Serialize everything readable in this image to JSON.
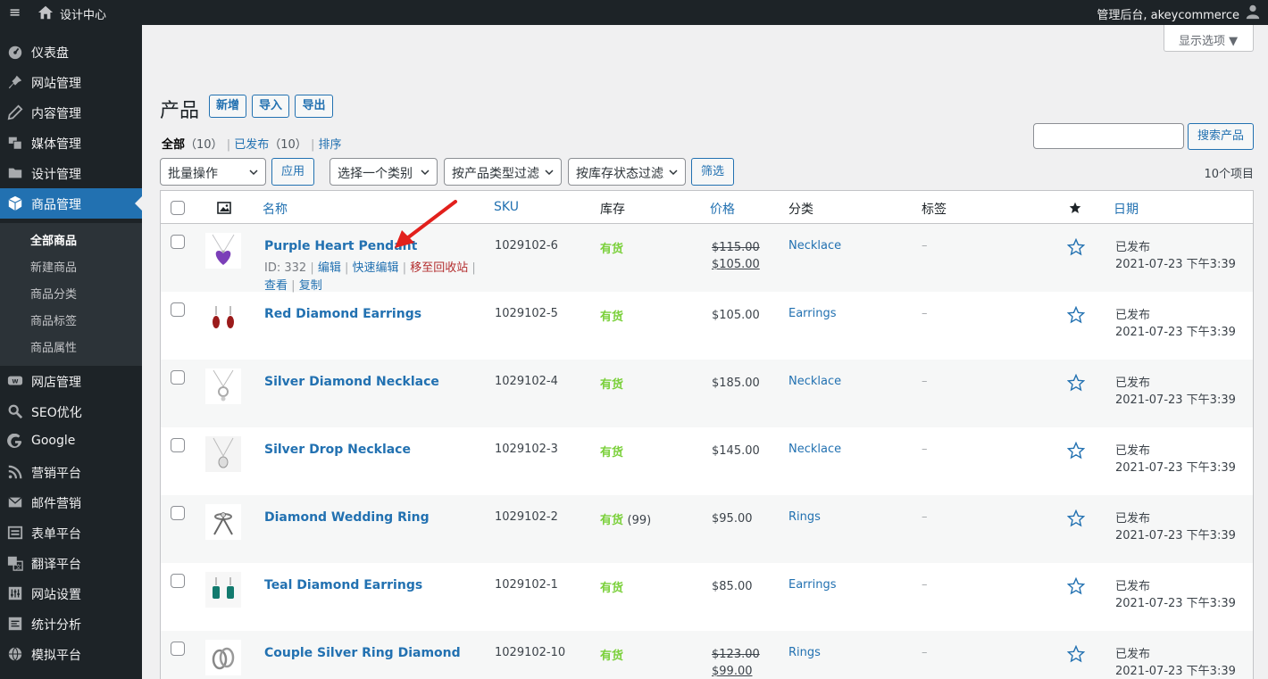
{
  "adminbar": {
    "menu_icon": "≡",
    "site_name": "设计中心",
    "account": "管理后台, akeycommerce"
  },
  "sidebar": {
    "items": [
      {
        "label": "仪表盘",
        "icon": "dashboard-icon"
      },
      {
        "label": "网站管理",
        "icon": "pin-icon"
      },
      {
        "label": "内容管理",
        "icon": "edit-icon"
      },
      {
        "label": "媒体管理",
        "icon": "media-icon"
      },
      {
        "label": "设计管理",
        "icon": "folder-icon"
      },
      {
        "label": "商品管理",
        "icon": "box-icon",
        "active": true
      },
      {
        "label": "网店管理",
        "icon": "woo-icon"
      },
      {
        "label": "SEO优化",
        "icon": "search-icon"
      },
      {
        "label": "Google",
        "icon": "google-icon"
      },
      {
        "label": "营销平台",
        "icon": "rss-icon"
      },
      {
        "label": "邮件营销",
        "icon": "mail-icon"
      },
      {
        "label": "表单平台",
        "icon": "form-icon"
      },
      {
        "label": "翻译平台",
        "icon": "translate-icon"
      },
      {
        "label": "网站设置",
        "icon": "settings-icon"
      },
      {
        "label": "统计分析",
        "icon": "chart-icon"
      },
      {
        "label": "模拟平台",
        "icon": "globe-icon"
      }
    ],
    "submenu": [
      "全部商品",
      "新建商品",
      "商品分类",
      "商品标签",
      "商品属性"
    ]
  },
  "screen_options": "显示选项 ▼",
  "page": {
    "title": "产品",
    "buttons": {
      "new": "新增",
      "import": "导入",
      "export": "导出"
    }
  },
  "views": {
    "all": "全部",
    "all_count": "（10）",
    "sep": "|",
    "published": "已发布",
    "published_count": "（10）",
    "sort": "排序"
  },
  "search": {
    "placeholder": "",
    "button": "搜索产品"
  },
  "filters": {
    "bulk": "批量操作",
    "apply": "应用",
    "category": "选择一个类别",
    "type": "按产品类型过滤",
    "stock": "按库存状态过滤",
    "filter_btn": "筛选",
    "count": "10个项目"
  },
  "columns": {
    "name": "名称",
    "sku": "SKU",
    "stock": "库存",
    "price": "价格",
    "category": "分类",
    "tags": "标签",
    "date": "日期"
  },
  "row_actions": {
    "id": "ID: 332",
    "edit": "编辑",
    "quick_edit": "快速编辑",
    "trash": "移至回收站",
    "view": "查看",
    "duplicate": "复制",
    "sep": "|"
  },
  "products": [
    {
      "name": "Purple Heart Pendant",
      "sku": "1029102-6",
      "stock": "有货",
      "stock_qty": "",
      "old_price": "$115.00",
      "price": "$105.00",
      "category": "Necklace",
      "tags": "–",
      "status": "已发布",
      "date": "2021-07-23 下午3:39",
      "thumb": "purple-heart"
    },
    {
      "name": "Red Diamond Earrings",
      "sku": "1029102-5",
      "stock": "有货",
      "stock_qty": "",
      "old_price": "",
      "price": "$105.00",
      "category": "Earrings",
      "tags": "–",
      "status": "已发布",
      "date": "2021-07-23 下午3:39",
      "thumb": "red-earrings"
    },
    {
      "name": "Silver Diamond Necklace",
      "sku": "1029102-4",
      "stock": "有货",
      "stock_qty": "",
      "old_price": "",
      "price": "$185.00",
      "category": "Necklace",
      "tags": "–",
      "status": "已发布",
      "date": "2021-07-23 下午3:39",
      "thumb": "silver-necklace"
    },
    {
      "name": "Silver Drop Necklace",
      "sku": "1029102-3",
      "stock": "有货",
      "stock_qty": "",
      "old_price": "",
      "price": "$145.00",
      "category": "Necklace",
      "tags": "–",
      "status": "已发布",
      "date": "2021-07-23 下午3:39",
      "thumb": "drop-necklace"
    },
    {
      "name": "Diamond Wedding Ring",
      "sku": "1029102-2",
      "stock": "有货",
      "stock_qty": "(99)",
      "old_price": "",
      "price": "$95.00",
      "category": "Rings",
      "tags": "–",
      "status": "已发布",
      "date": "2021-07-23 下午3:39",
      "thumb": "wedding-ring"
    },
    {
      "name": "Teal Diamond Earrings",
      "sku": "1029102-1",
      "stock": "有货",
      "stock_qty": "",
      "old_price": "",
      "price": "$85.00",
      "category": "Earrings",
      "tags": "–",
      "status": "已发布",
      "date": "2021-07-23 下午3:39",
      "thumb": "teal-earrings"
    },
    {
      "name": "Couple Silver Ring Diamond",
      "sku": "1029102-10",
      "stock": "有货",
      "stock_qty": "",
      "old_price": "$123.00",
      "price": "$99.00",
      "category": "Rings",
      "tags": "–",
      "status": "已发布",
      "date": "2021-07-23 下午3:39",
      "thumb": "couple-rings"
    }
  ],
  "colors": {
    "accent": "#2271b1",
    "sidebar": "#1d2327",
    "in_stock": "#7ad03a",
    "danger": "#b32d2e",
    "annotation_arrow": "#e2201c"
  }
}
